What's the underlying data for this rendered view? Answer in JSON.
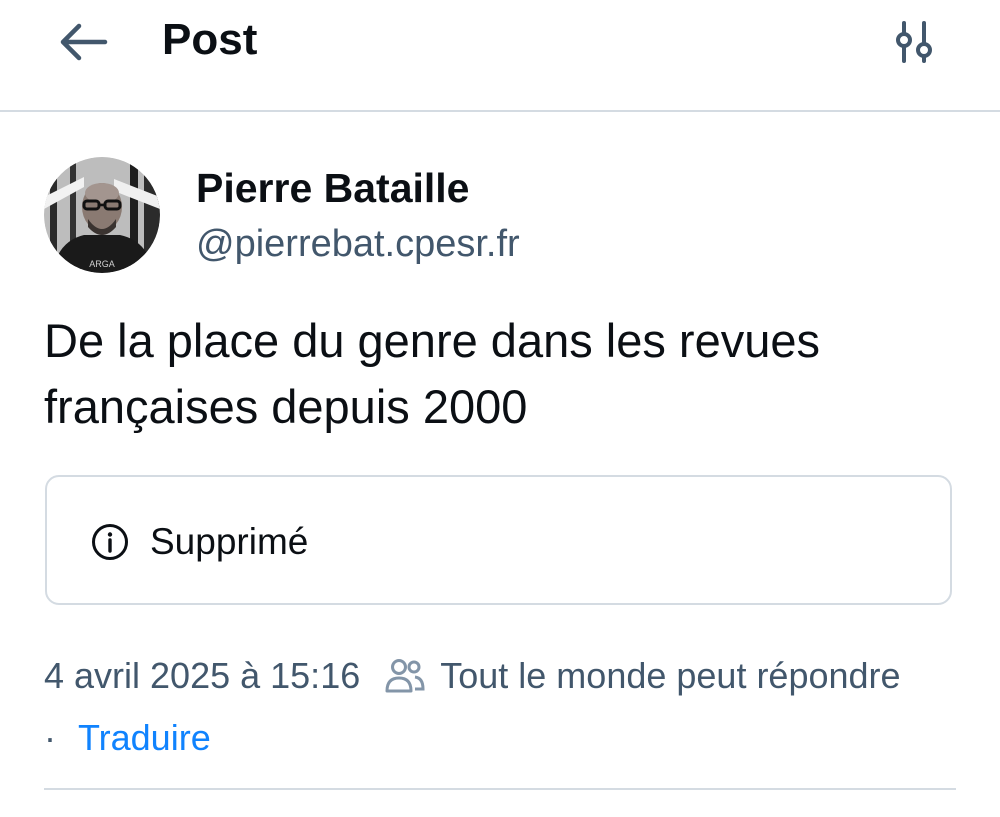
{
  "header": {
    "title": "Post",
    "back_icon": "arrow-left-icon",
    "filter_icon": "sliders-icon"
  },
  "author": {
    "name": "Pierre Bataille",
    "handle": "@pierrebat.cpesr.fr",
    "avatar_icon": "avatar-photo"
  },
  "post": {
    "text": "De la place du genre dans les revues françaises depuis 2000"
  },
  "embed": {
    "status_icon": "info-circle-icon",
    "status": "Supprimé"
  },
  "meta": {
    "date": "4 avril 2025 à 15:16",
    "reply_icon": "people-icon",
    "reply_setting": "Tout le monde peut répondre",
    "separator": "·",
    "translate": "Traduire"
  },
  "colors": {
    "text": "#0b0f14",
    "muted": "#42576c",
    "link": "#1083fe",
    "border": "#d4dbe2"
  }
}
